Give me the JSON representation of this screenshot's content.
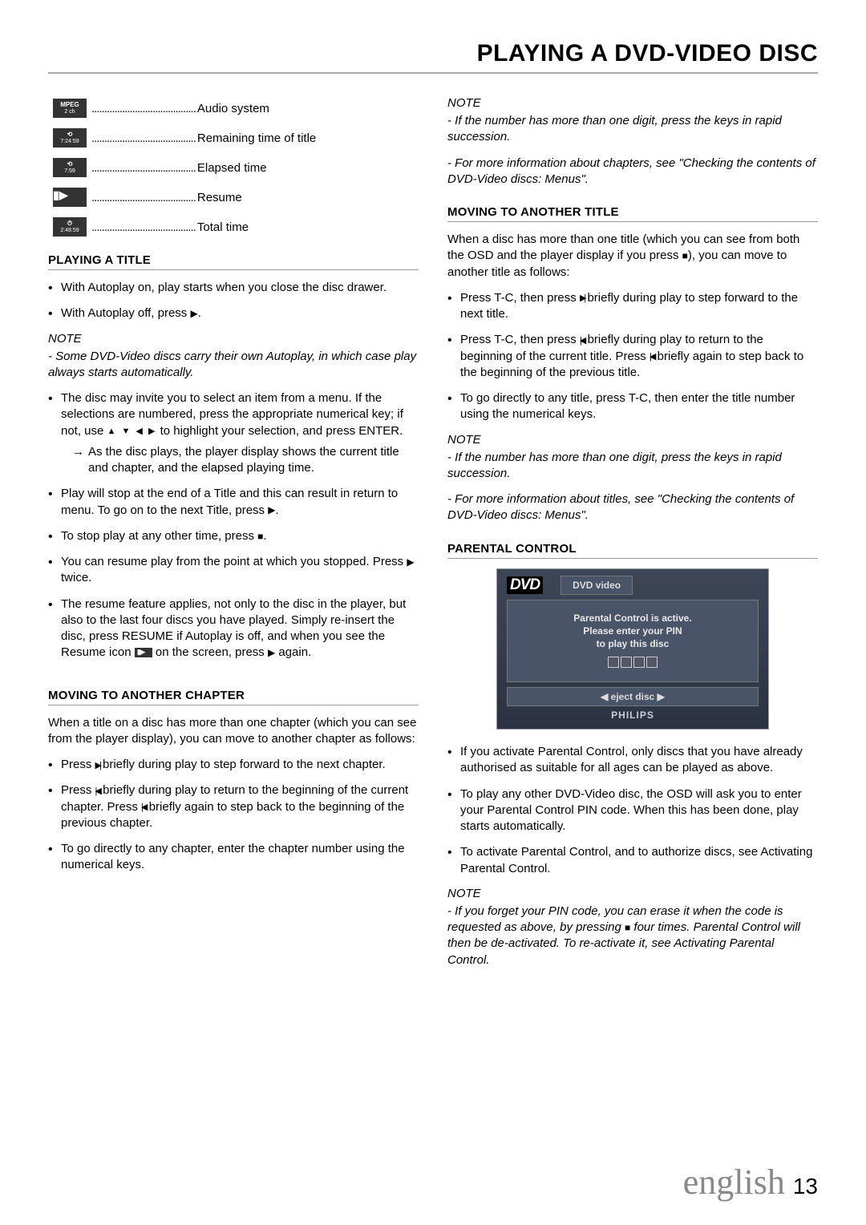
{
  "page_title": "PLAYING A DVD-VIDEO DISC",
  "icon_list": [
    {
      "line1": "MPEG",
      "line2": "2 ch",
      "label": "Audio system"
    },
    {
      "line1": "⟲",
      "line2": "7:24:59",
      "label": "Remaining time of title"
    },
    {
      "line1": "⟲",
      "line2": "7:59",
      "label": "Elapsed time"
    },
    {
      "line1": "▮▶",
      "line2": "",
      "label": "Resume"
    },
    {
      "line1": "⏱",
      "line2": "2:48:59",
      "label": "Total time"
    }
  ],
  "left": {
    "playing_title_head": "PLAYING A TITLE",
    "pt_b1": "With Autoplay on, play starts when you close the disc drawer.",
    "pt_b2_pre": "With Autoplay off, press ",
    "pt_b2_post": ".",
    "note_head": "NOTE",
    "pt_note1": "- Some DVD-Video discs carry their own Autoplay, in which case play always starts automatically.",
    "pt_b3_a": "The disc may invite you to select an item from a menu. If the selections are numbered, press the appropriate numerical key; if not, use ",
    "pt_b3_b": " to highlight your selection, and press ENTER.",
    "pt_b3_sub": "As the disc plays, the player display shows the current title and chapter, and the elapsed playing time.",
    "pt_b4_a": "Play will stop at the end of a Title and this can result in return to menu. To go on to the next Title, press ",
    "pt_b4_b": ".",
    "pt_b5_a": "To stop play at any other time, press ",
    "pt_b5_b": ".",
    "pt_b6_a": "You can resume play from the point at which you stopped. Press ",
    "pt_b6_b": " twice.",
    "pt_b7_a": "The resume feature applies, not only to the disc in the player, but also to the last four discs you have played. Simply re-insert the disc, press RESUME if Autoplay is off, and when you see the Resume icon ",
    "pt_b7_b": " on the screen, press ",
    "pt_b7_c": " again.",
    "mac_head": "MOVING TO ANOTHER CHAPTER",
    "mac_intro": "When a title on a disc has more than one chapter (which you can see from the player display), you can move to another chapter as follows:",
    "mac_b1_a": "Press ",
    "mac_b1_b": " briefly during play to step forward to the next chapter.",
    "mac_b2_a": "Press ",
    "mac_b2_b": " briefly during play to return to the beginning of the current chapter. Press ",
    "mac_b2_c": " briefly again to step back to the beginning of the previous chapter.",
    "mac_b3": "To go directly to any chapter, enter the chapter number using the numerical keys."
  },
  "right": {
    "note_head": "NOTE",
    "top_note1": "- If the number has more than one digit, press the keys in rapid succession.",
    "top_note2": "- For more information about chapters, see \"Checking the contents of DVD-Video discs: Menus\".",
    "mat_head": "MOVING TO ANOTHER TITLE",
    "mat_intro_a": "When a disc has more than one title (which you can see from both the OSD and the player display if you press ",
    "mat_intro_b": "), you can move to another title as follows:",
    "mat_b1_a": "Press T-C, then press ",
    "mat_b1_b": " briefly during play to step forward to the next title.",
    "mat_b2_a": "Press T-C, then press ",
    "mat_b2_b": " briefly during play to return to the beginning of the current title. Press ",
    "mat_b2_c": " briefly again to step back to the beginning of the previous title.",
    "mat_b3": "To go directly to any title, press T-C, then enter the title number using the numerical keys.",
    "mat_note1": "- If the number has more than one digit, press the keys in rapid succession.",
    "mat_note2": "- For more information about titles, see \"Checking the contents of DVD-Video discs: Menus\".",
    "pc_head": "PARENTAL CONTROL",
    "panel": {
      "logo": "DVD",
      "tab": "DVD video",
      "msg1": "Parental Control is active.",
      "msg2": "Please enter your PIN",
      "msg3": "to play this disc",
      "eject": "◀ eject disc ▶",
      "brand": "PHILIPS"
    },
    "pc_b1": "If you activate Parental Control, only discs that you have already authorised as suitable for all ages can be played as above.",
    "pc_b2": "To play any other DVD-Video disc, the OSD will ask you to enter your Parental Control PIN code. When this has been done, play starts automatically.",
    "pc_b3": "To activate Parental Control, and to authorize discs, see Activating Parental Control.",
    "pc_note_a": "- If you forget your PIN code, you can erase it when the code is requested as above, by pressing ",
    "pc_note_b": " four times. Parental Control will then be de-activated. To re-activate it, see Activating Parental Control."
  },
  "footer": {
    "lang": "english",
    "page": "13"
  }
}
